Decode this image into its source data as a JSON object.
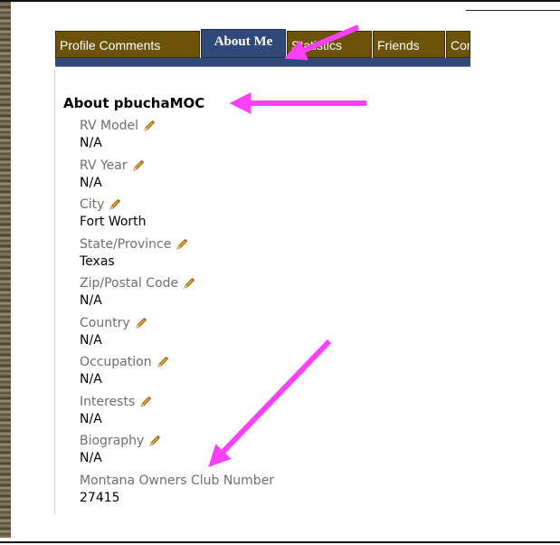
{
  "tabs": [
    {
      "label": "Profile Comments"
    },
    {
      "label": "About Me"
    },
    {
      "label": "Statistics"
    },
    {
      "label": "Friends"
    },
    {
      "label": "Con"
    }
  ],
  "about": {
    "title": "About pbuchaMOC",
    "fields": [
      {
        "label": "RV Model",
        "value": "N/A",
        "editable": true
      },
      {
        "label": "RV Year",
        "value": "N/A",
        "editable": true
      },
      {
        "label": "City",
        "value": "Fort Worth",
        "editable": true
      },
      {
        "label": "State/Province",
        "value": "Texas",
        "editable": true
      },
      {
        "label": "Zip/Postal Code",
        "value": "N/A",
        "editable": true
      },
      {
        "label": "Country",
        "value": "N/A",
        "editable": true
      },
      {
        "label": "Occupation",
        "value": "N/A",
        "editable": true
      },
      {
        "label": "Interests",
        "value": "N/A",
        "editable": true
      },
      {
        "label": "Biography",
        "value": "N/A",
        "editable": true
      },
      {
        "label": "Montana Owners Club Number",
        "value": "27415",
        "editable": false
      }
    ]
  },
  "icons": {
    "edit": "pencil-icon",
    "annotation": "arrow-annotation"
  },
  "colors": {
    "tab_bg": "#6b5208",
    "tab_active": "#2f4a78",
    "arrow": "#ff40ff",
    "label": "#6f6f6f"
  }
}
